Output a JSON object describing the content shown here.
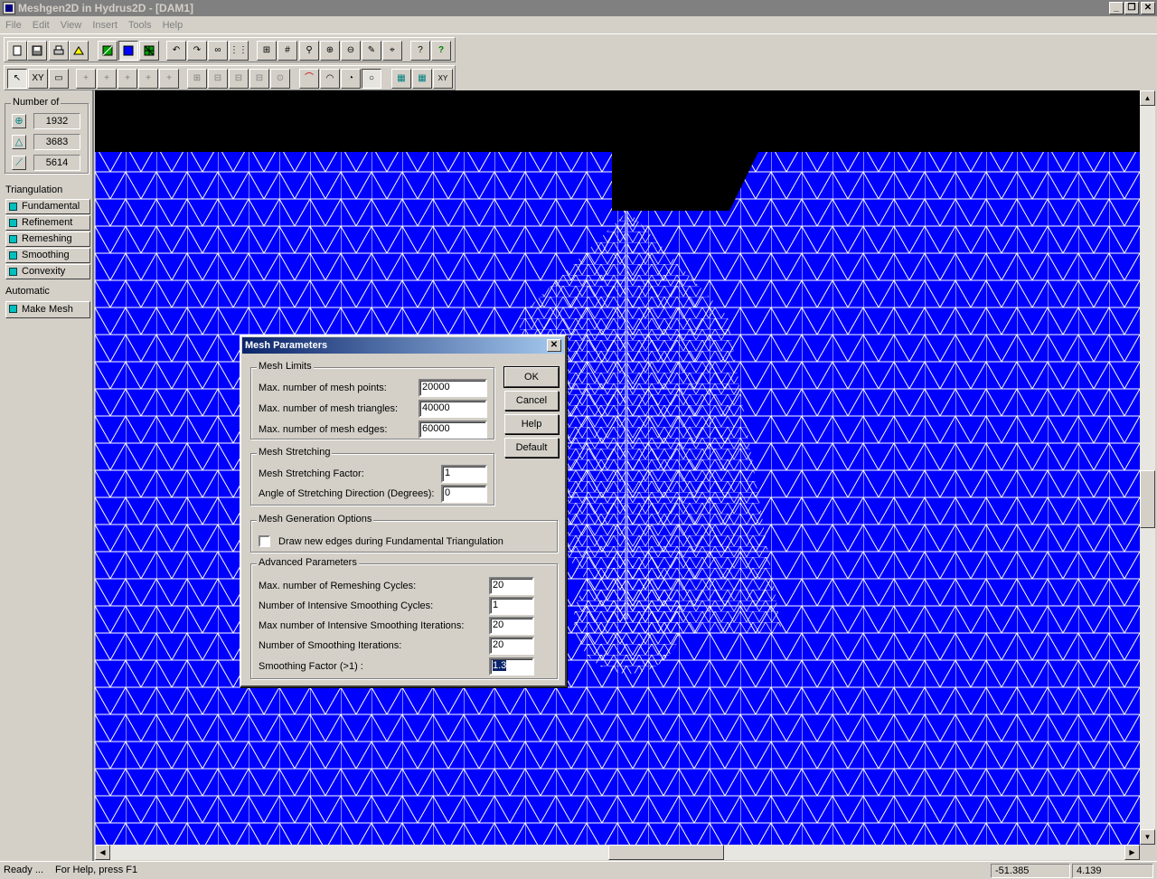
{
  "window": {
    "title": "Meshgen2D in Hydrus2D - [DAM1]"
  },
  "menu": [
    "File",
    "Edit",
    "View",
    "Insert",
    "Tools",
    "Help"
  ],
  "toolbar1_icons": [
    "new-icon",
    "save-icon",
    "print-icon",
    "print-setup-icon",
    "boundary-icon",
    "fill-icon",
    "mesh-icon",
    "undo-icon",
    "redo-icon",
    "glasses-icon",
    "grid-dots-icon",
    "zoom-extents-icon",
    "grid-icon",
    "zoom-icon",
    "zoom-in-icon",
    "zoom-out-icon",
    "pencil-icon",
    "target-icon",
    "context-help-icon",
    "help-icon"
  ],
  "toolbar2_icons": [
    "pointer-icon",
    "xy-icon",
    "document-icon",
    "point-icon",
    "point-edit-icon",
    "point-move-icon",
    "point-delete-icon",
    "point-insert-icon",
    "grid-add-icon",
    "grid-edit-icon",
    "grid-move-icon",
    "grid-delete-icon",
    "grid-insert-icon",
    "arc-icon",
    "arc-center-icon",
    "circle-icon",
    "circle-select-icon",
    "node-select-icon",
    "node-group-icon",
    "xy-grid-icon"
  ],
  "toolbar2_labels": {
    "xy": "XY"
  },
  "panel": {
    "number_of_label": "Number of",
    "counts": [
      {
        "icon": "node-icon",
        "value": "1932"
      },
      {
        "icon": "triangle-icon",
        "value": "3683"
      },
      {
        "icon": "edge-icon",
        "value": "5614"
      }
    ],
    "triangulation_label": "Triangulation",
    "triangulation_buttons": [
      "Fundamental",
      "Refinement",
      "Remeshing",
      "Smoothing",
      "Convexity"
    ],
    "automatic_label": "Automatic",
    "make_mesh": "Make Mesh"
  },
  "colors": {
    "mesh_fill": "#0000ff",
    "mesh_lines": "#ffffff",
    "background": "#000000",
    "dialog_title": "#0a246a"
  },
  "dialog": {
    "title": "Mesh Parameters",
    "buttons": {
      "ok": "OK",
      "cancel": "Cancel",
      "help": "Help",
      "default": "Default"
    },
    "mesh_limits": {
      "label": "Mesh Limits",
      "points_label": "Max. number of mesh points:",
      "points_value": "20000",
      "triangles_label": "Max. number of mesh triangles:",
      "triangles_value": "40000",
      "edges_label": "Max. number of mesh edges:",
      "edges_value": "60000"
    },
    "mesh_stretching": {
      "label": "Mesh Stretching",
      "factor_label": "Mesh Stretching Factor:",
      "factor_value": "1",
      "angle_label": "Angle of Stretching Direction (Degrees):",
      "angle_value": "0"
    },
    "generation_options": {
      "label": "Mesh Generation Options",
      "draw_edges_label": "Draw new edges during Fundamental Triangulation",
      "draw_edges_checked": false
    },
    "advanced": {
      "label": "Advanced Parameters",
      "remeshing_label": "Max. number of Remeshing Cycles:",
      "remeshing_value": "20",
      "intensive_cycles_label": "Number of Intensive Smoothing Cycles:",
      "intensive_cycles_value": "1",
      "intensive_iter_label": "Max number of Intensive Smoothing Iterations:",
      "intensive_iter_value": "20",
      "smoothing_iter_label": "Number of Smoothing Iterations:",
      "smoothing_iter_value": "20",
      "smoothing_factor_label": "Smoothing Factor (>1) :",
      "smoothing_factor_value": "1.3"
    }
  },
  "status": {
    "ready": "Ready ...",
    "help": "For Help, press F1",
    "x": "-51.385",
    "y": "4.139"
  }
}
